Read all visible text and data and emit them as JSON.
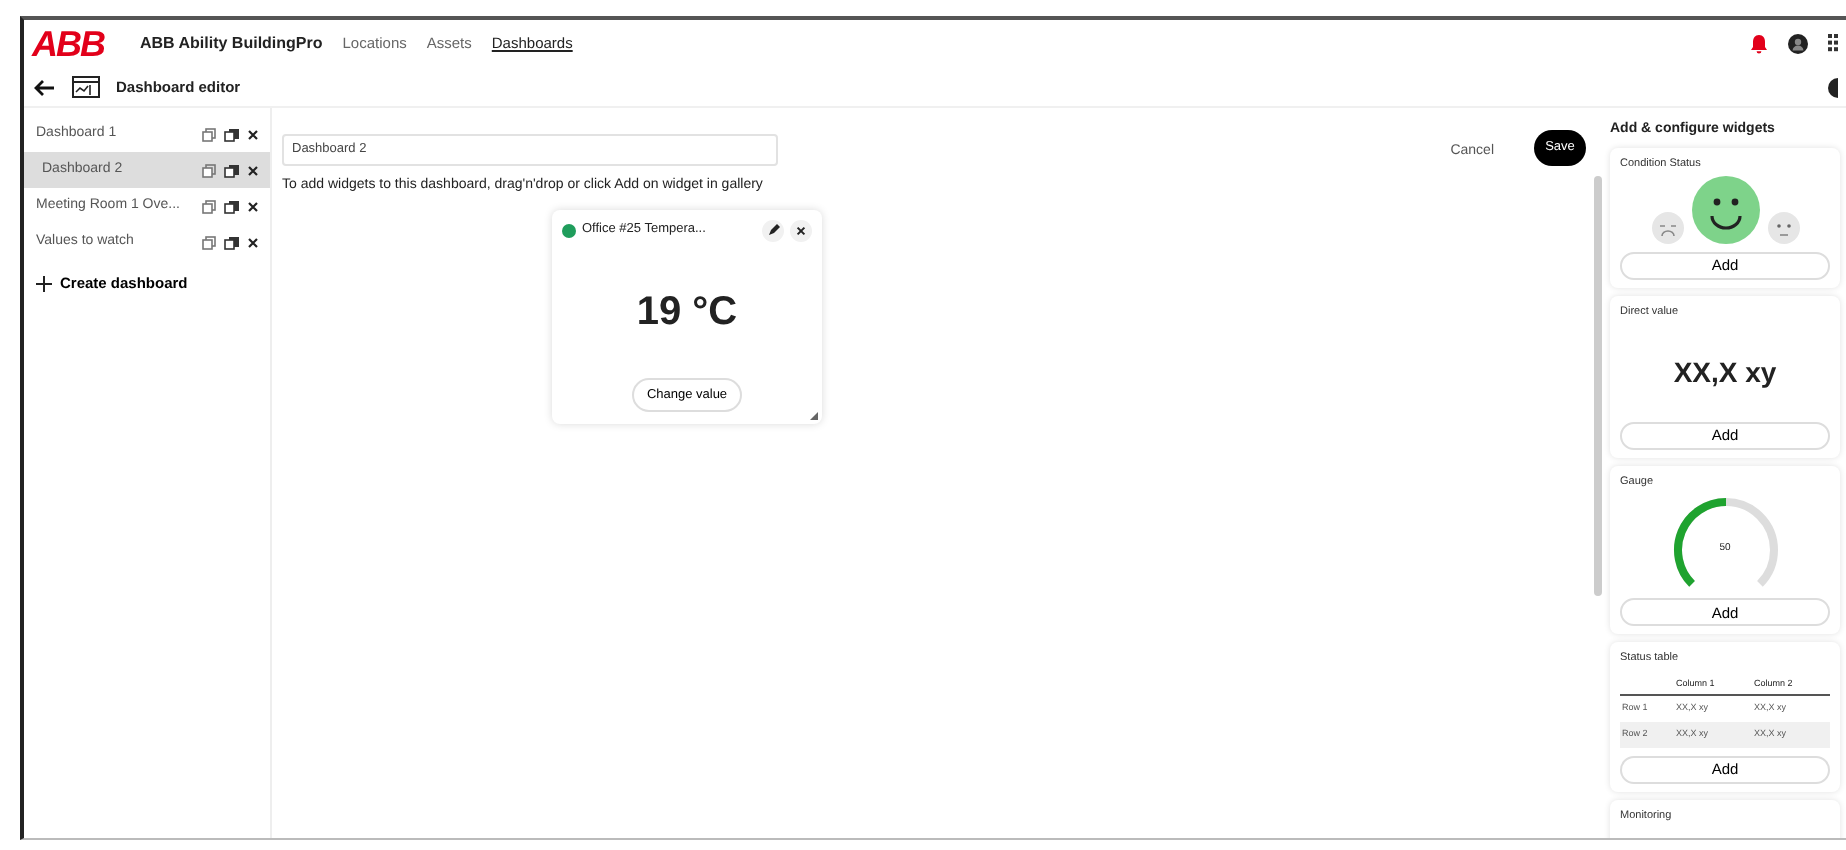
{
  "header": {
    "logo": "ABB",
    "app_name": "ABB Ability BuildingPro",
    "nav": [
      {
        "label": "Locations",
        "selected": false
      },
      {
        "label": "Assets",
        "selected": false
      },
      {
        "label": "Dashboards",
        "selected": true
      }
    ]
  },
  "toolbar": {
    "title": "Dashboard editor"
  },
  "sidebar": {
    "items": [
      {
        "label": "Dashboard 1",
        "selected": false
      },
      {
        "label": "Dashboard 2",
        "selected": true
      },
      {
        "label": "Meeting Room 1 Ove...",
        "selected": false
      },
      {
        "label": "Values to watch",
        "selected": false
      }
    ],
    "create": "Create dashboard"
  },
  "editor": {
    "name_value": "Dashboard 2",
    "hint": "To add widgets to this dashboard, drag'n'drop or click Add on widget in gallery",
    "cancel": "Cancel",
    "save": "Save",
    "widgets": [
      {
        "title": "Office #25 Tempera...",
        "color": "#1f9d5c",
        "value": "19 °C",
        "action": "Change value"
      }
    ]
  },
  "gallery": {
    "title": "Add & configure widgets",
    "widgets": [
      {
        "kind": "condition",
        "title": "Condition Status",
        "button": "Add"
      },
      {
        "kind": "direct",
        "title": "Direct value",
        "value": "XX,X xy",
        "button": "Add"
      },
      {
        "kind": "gauge",
        "title": "Gauge",
        "reading": "50",
        "button": "Add"
      },
      {
        "kind": "table",
        "title": "Status table",
        "columns": [
          "Column 1",
          "Column 2"
        ],
        "rows": [
          {
            "label": "Row 1",
            "cells": [
              "XX,X xy",
              "XX,X xy"
            ]
          },
          {
            "label": "Row 2",
            "cells": [
              "XX,X xy",
              "XX,X xy"
            ]
          }
        ],
        "button": "Add"
      },
      {
        "kind": "monitoring",
        "title": "Monitoring"
      }
    ]
  }
}
